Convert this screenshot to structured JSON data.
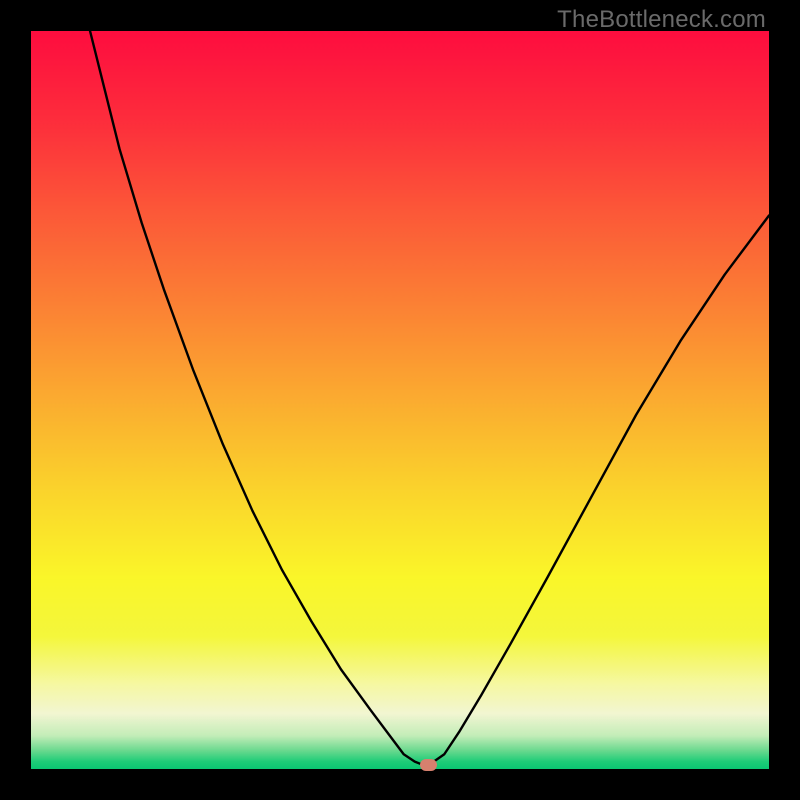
{
  "watermark": "TheBottleneck.com",
  "chart_data": {
    "type": "line",
    "title": "",
    "xlabel": "",
    "ylabel": "",
    "xlim": [
      0,
      100
    ],
    "ylim": [
      0,
      100
    ],
    "grid": false,
    "legend": false,
    "series": [
      {
        "name": "bottleneck-curve",
        "x": [
          8,
          10,
          12,
          15,
          18,
          22,
          26,
          30,
          34,
          38,
          42,
          46,
          49,
          50.5,
          52,
          53,
          54,
          56,
          58,
          61,
          65,
          70,
          76,
          82,
          88,
          94,
          100
        ],
        "y": [
          100,
          92,
          84,
          74,
          65,
          54,
          44,
          35,
          27,
          20,
          13.5,
          8,
          4,
          2,
          1,
          0.6,
          0.6,
          2,
          5,
          10,
          17,
          26,
          37,
          48,
          58,
          67,
          75
        ]
      }
    ],
    "marker": {
      "x": 53.8,
      "y": 0.6,
      "color": "#d6806e"
    },
    "gradient_stops": [
      {
        "pos": 0.0,
        "color": "#fe0d3f"
      },
      {
        "pos": 0.12,
        "color": "#fd2d3c"
      },
      {
        "pos": 0.25,
        "color": "#fc5a38"
      },
      {
        "pos": 0.38,
        "color": "#fb8434"
      },
      {
        "pos": 0.5,
        "color": "#fbac30"
      },
      {
        "pos": 0.62,
        "color": "#fad32c"
      },
      {
        "pos": 0.74,
        "color": "#faf629"
      },
      {
        "pos": 0.82,
        "color": "#f4f73c"
      },
      {
        "pos": 0.885,
        "color": "#f6f8a2"
      },
      {
        "pos": 0.925,
        "color": "#f2f6d2"
      },
      {
        "pos": 0.955,
        "color": "#c3edb8"
      },
      {
        "pos": 0.975,
        "color": "#6ad98f"
      },
      {
        "pos": 0.99,
        "color": "#1ecd78"
      },
      {
        "pos": 1.0,
        "color": "#0bc772"
      }
    ]
  }
}
